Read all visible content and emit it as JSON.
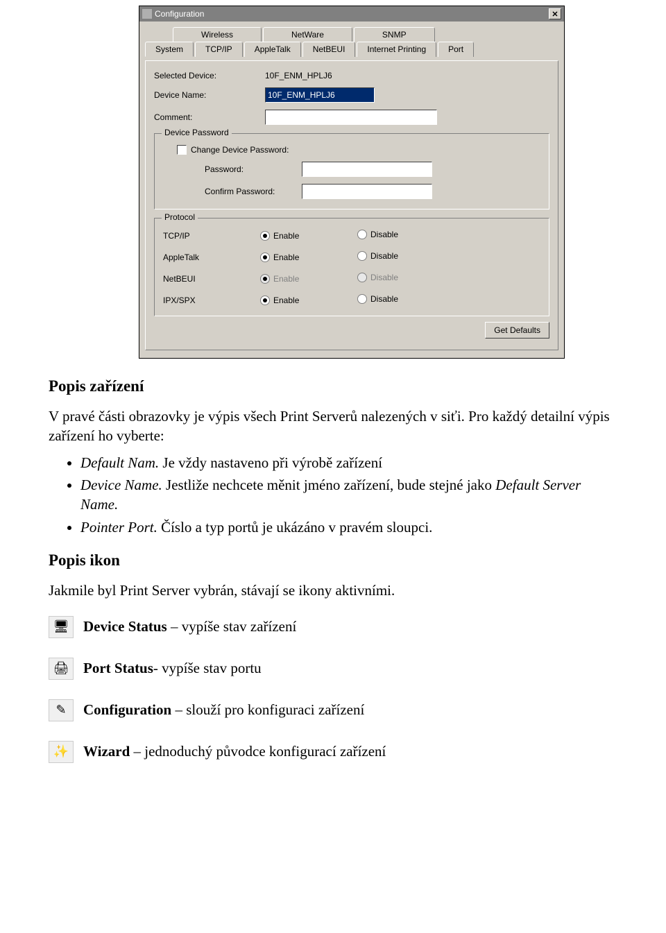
{
  "screenshot": {
    "title": "Configuration",
    "tabs_back": [
      "Wireless",
      "NetWare",
      "SNMP"
    ],
    "tabs_front": [
      "System",
      "TCP/IP",
      "AppleTalk",
      "NetBEUI",
      "Internet Printing",
      "Port"
    ],
    "selected_device_label": "Selected Device:",
    "selected_device_value": "10F_ENM_HPLJ6",
    "device_name_label": "Device Name:",
    "device_name_value": "10F_ENM_HPLJ6",
    "comment_label": "Comment:",
    "comment_value": "",
    "device_password_legend": "Device Password",
    "change_pw_label": "Change Device Password:",
    "password_label": "Password:",
    "confirm_label": "Confirm Password:",
    "protocol_legend": "Protocol",
    "enable_label": "Enable",
    "disable_label": "Disable",
    "protocols": [
      {
        "name": "TCP/IP",
        "enabled": true,
        "grayed": false
      },
      {
        "name": "AppleTalk",
        "enabled": true,
        "grayed": false
      },
      {
        "name": "NetBEUI",
        "enabled": true,
        "grayed": true
      },
      {
        "name": "IPX/SPX",
        "enabled": true,
        "grayed": false
      }
    ],
    "get_defaults": "Get Defaults"
  },
  "doc": {
    "h1": "Popis zařízení",
    "p1": "V pravé části obrazovky je výpis všech Print Serverů nalezených v siťi. Pro každý detailní výpis zařízení ho vyberte:",
    "b1_term": "Default Nam.",
    "b1_rest": " Je vždy nastaveno při výrobě zařízení",
    "b2_term": "Device Name.",
    "b2_rest_a": " Jestliže nechcete měnit jméno zařízení, bude stejné jako ",
    "b2_rest_i": "Default Server Name.",
    "b3_term": "Pointer Port.",
    "b3_rest": " Číslo a typ portů je ukázáno v pravém sloupci.",
    "h2": "Popis ikon",
    "p2": "Jakmile byl Print Server vybrán, stávají se ikony aktivními.",
    "i1_b": "Device Status",
    "i1_r": " – vypíše stav zařízení",
    "i2_b": "Port Status",
    "i2_r": "- vypíše stav portu",
    "i3_b": "Configuration",
    "i3_r": " – slouží pro konfiguraci zařízení",
    "i4_b": "Wizard",
    "i4_r": " – jednoduchý původce konfigurací zařízení"
  }
}
